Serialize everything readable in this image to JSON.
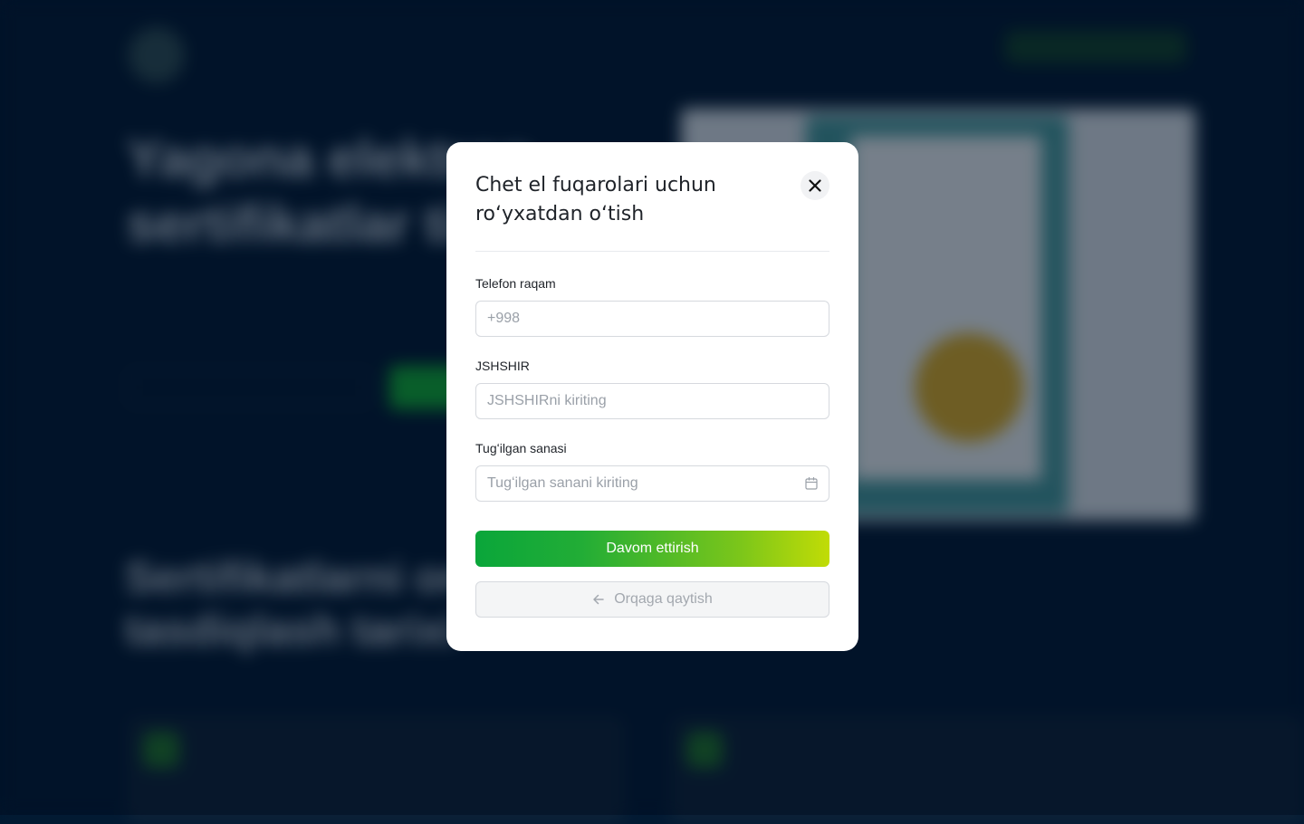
{
  "background": {
    "hero_title": "Yagona elektron sertifikatlar tizimi",
    "section_title": "Sertifikatlarni onlayn tasdiqlash tarixi"
  },
  "modal": {
    "title": "Chet el fuqarolari uchun roʻyxatdan oʻtish",
    "fields": {
      "phone": {
        "label": "Telefon raqam",
        "placeholder": "+998"
      },
      "jshshir": {
        "label": "JSHSHIR",
        "placeholder": "JSHSHIRni kiriting"
      },
      "birth_date": {
        "label": "Tugʻilgan sanasi",
        "placeholder": "Tugʻilgan sanani kiriting"
      }
    },
    "continue_label": "Davom ettirish",
    "back_label": "Orqaga qaytish"
  },
  "colors": {
    "accent_gradient_start": "#0aa63a",
    "accent_gradient_end": "#c1dc06",
    "backdrop": "#021a33"
  },
  "icons": {
    "close": "close-icon",
    "calendar": "calendar-icon",
    "back": "arrow-left-icon"
  }
}
